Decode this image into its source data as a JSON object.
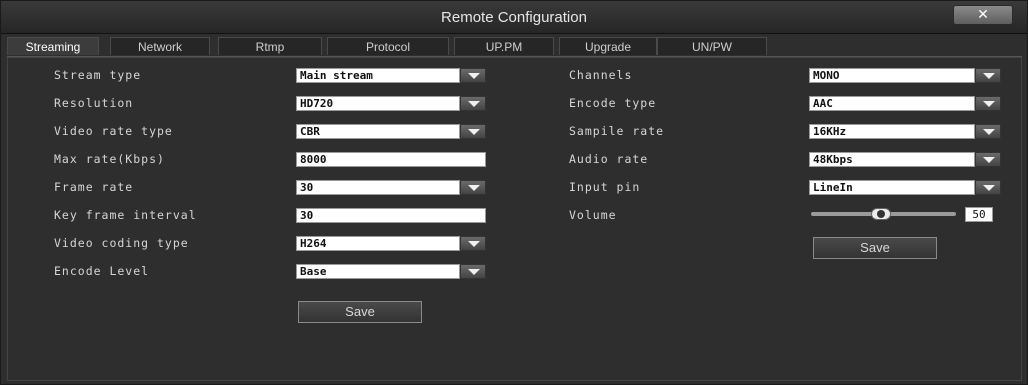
{
  "window": {
    "title": "Remote Configuration",
    "close_label": "✕"
  },
  "tabs": [
    {
      "label": "Streaming"
    },
    {
      "label": "Network"
    },
    {
      "label": "Rtmp"
    },
    {
      "label": "Protocol"
    },
    {
      "label": "UP.PM"
    },
    {
      "label": "Upgrade"
    },
    {
      "label": "UN/PW"
    }
  ],
  "video": {
    "stream_type": {
      "label": "Stream type",
      "value": "Main stream"
    },
    "resolution": {
      "label": "Resolution",
      "value": "HD720"
    },
    "video_rate_type": {
      "label": "Video rate type",
      "value": "CBR"
    },
    "max_rate": {
      "label": "Max rate(Kbps)",
      "value": "8000"
    },
    "frame_rate": {
      "label": "Frame rate",
      "value": "30"
    },
    "key_frame_interval": {
      "label": "Key frame interval",
      "value": "30"
    },
    "video_coding_type": {
      "label": "Video coding type",
      "value": "H264"
    },
    "encode_level": {
      "label": "Encode Level",
      "value": "Base"
    },
    "save_label": "Save"
  },
  "audio": {
    "channels": {
      "label": "Channels",
      "value": "MONO"
    },
    "encode_type": {
      "label": "Encode type",
      "value": "AAC"
    },
    "sample_rate": {
      "label": "Sampile rate",
      "value": "16KHz"
    },
    "audio_rate": {
      "label": "Audio rate",
      "value": "48Kbps"
    },
    "input_pin": {
      "label": "Input pin",
      "value": "LineIn"
    },
    "volume": {
      "label": "Volume",
      "value": "50"
    },
    "save_label": "Save"
  }
}
